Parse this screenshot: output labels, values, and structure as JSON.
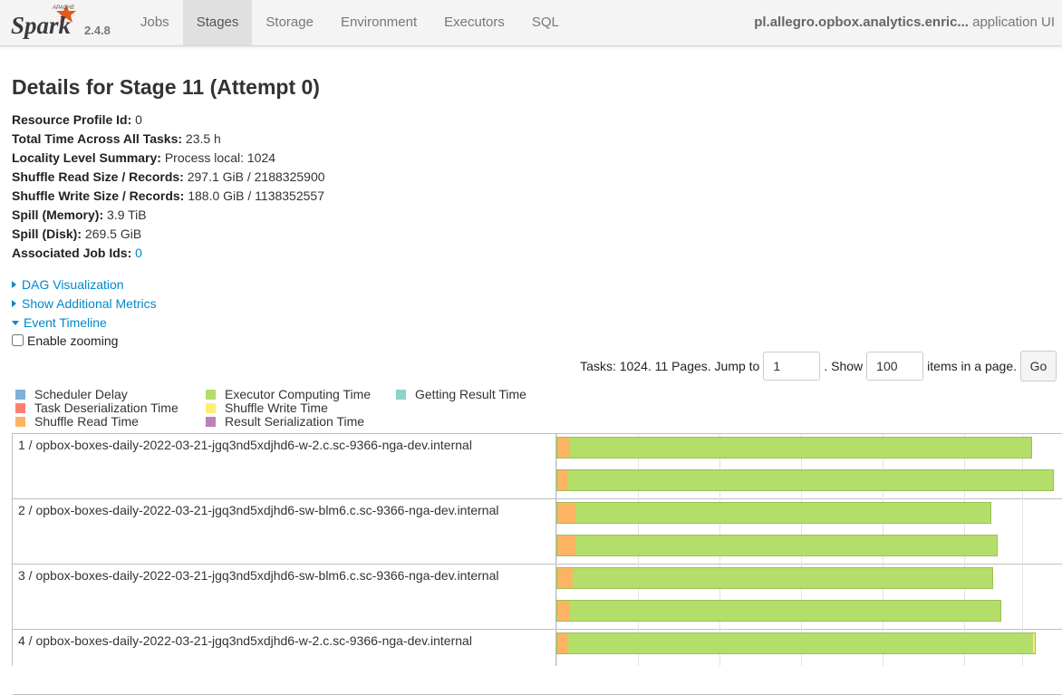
{
  "navbar": {
    "logo_text": "Spark",
    "logo_small": "APACHE",
    "version": "2.4.8",
    "tabs": [
      {
        "label": "Jobs",
        "active": false
      },
      {
        "label": "Stages",
        "active": true
      },
      {
        "label": "Storage",
        "active": false
      },
      {
        "label": "Environment",
        "active": false
      },
      {
        "label": "Executors",
        "active": false
      },
      {
        "label": "SQL",
        "active": false
      }
    ],
    "app_name": "pl.allegro.opbox.analytics.enric...",
    "app_suffix": "application UI"
  },
  "page_title": "Details for Stage 11 (Attempt 0)",
  "summary": {
    "resource_profile_label": "Resource Profile Id:",
    "resource_profile_value": "0",
    "total_time_label": "Total Time Across All Tasks:",
    "total_time_value": "23.5 h",
    "locality_label": "Locality Level Summary:",
    "locality_value": "Process local: 1024",
    "shuffle_read_label": "Shuffle Read Size / Records:",
    "shuffle_read_value": "297.1 GiB / 2188325900",
    "shuffle_write_label": "Shuffle Write Size / Records:",
    "shuffle_write_value": "188.0 GiB / 1138352557",
    "spill_memory_label": "Spill (Memory):",
    "spill_memory_value": "3.9 TiB",
    "spill_disk_label": "Spill (Disk):",
    "spill_disk_value": "269.5 GiB",
    "job_ids_label": "Associated Job Ids:",
    "job_ids_value": "0"
  },
  "expanders": {
    "dag": "DAG Visualization",
    "metrics": "Show Additional Metrics",
    "timeline": "Event Timeline"
  },
  "enable_zooming": "Enable zooming",
  "pager": {
    "text_before": "Tasks: 1024. 11 Pages. Jump to",
    "page_value": "1",
    "text_show": ". Show",
    "page_size_value": "100",
    "text_after": "items in a page.",
    "go_label": "Go"
  },
  "legend": [
    {
      "label": "Scheduler Delay",
      "color": "#80b1d3"
    },
    {
      "label": "Task Deserialization Time",
      "color": "#fb8072"
    },
    {
      "label": "Shuffle Read Time",
      "color": "#fdb462"
    },
    {
      "label": "Executor Computing Time",
      "color": "#b3de69"
    },
    {
      "label": "Shuffle Write Time",
      "color": "#ffed6f"
    },
    {
      "label": "Result Serialization Time",
      "color": "#bc80bd"
    },
    {
      "label": "Getting Result Time",
      "color": "#8dd3c7"
    }
  ],
  "timeline": {
    "executors": [
      {
        "label": "1 / opbox-boxes-daily-2022-03-21-jgq3nd5xdjhd6-w-2.c.sc-9366-nga-dev.internal",
        "tasks": [
          {
            "start": 0.0,
            "end": 0.937,
            "shuffle_read": 0.025,
            "shuffle_write": 0.0
          },
          {
            "start": 0.0,
            "end": 0.98,
            "shuffle_read": 0.02,
            "shuffle_write": 0.0
          }
        ]
      },
      {
        "label": "2 / opbox-boxes-daily-2022-03-21-jgq3nd5xdjhd6-sw-blm6.c.sc-9366-nga-dev.internal",
        "tasks": [
          {
            "start": 0.0,
            "end": 0.857,
            "shuffle_read": 0.035,
            "shuffle_write": 0.0
          },
          {
            "start": 0.0,
            "end": 0.87,
            "shuffle_read": 0.036,
            "shuffle_write": 0.0
          }
        ]
      },
      {
        "label": "3 / opbox-boxes-daily-2022-03-21-jgq3nd5xdjhd6-sw-blm6.c.sc-9366-nga-dev.internal",
        "tasks": [
          {
            "start": 0.0,
            "end": 0.86,
            "shuffle_read": 0.03,
            "shuffle_write": 0.0
          },
          {
            "start": 0.0,
            "end": 0.877,
            "shuffle_read": 0.025,
            "shuffle_write": 0.0
          }
        ]
      },
      {
        "label": "4 / opbox-boxes-daily-2022-03-21-jgq3nd5xdjhd6-w-2.c.sc-9366-nga-dev.internal",
        "tasks": [
          {
            "start": 0.0,
            "end": 0.945,
            "shuffle_read": 0.022,
            "shuffle_write": 0.004
          }
        ]
      }
    ]
  }
}
